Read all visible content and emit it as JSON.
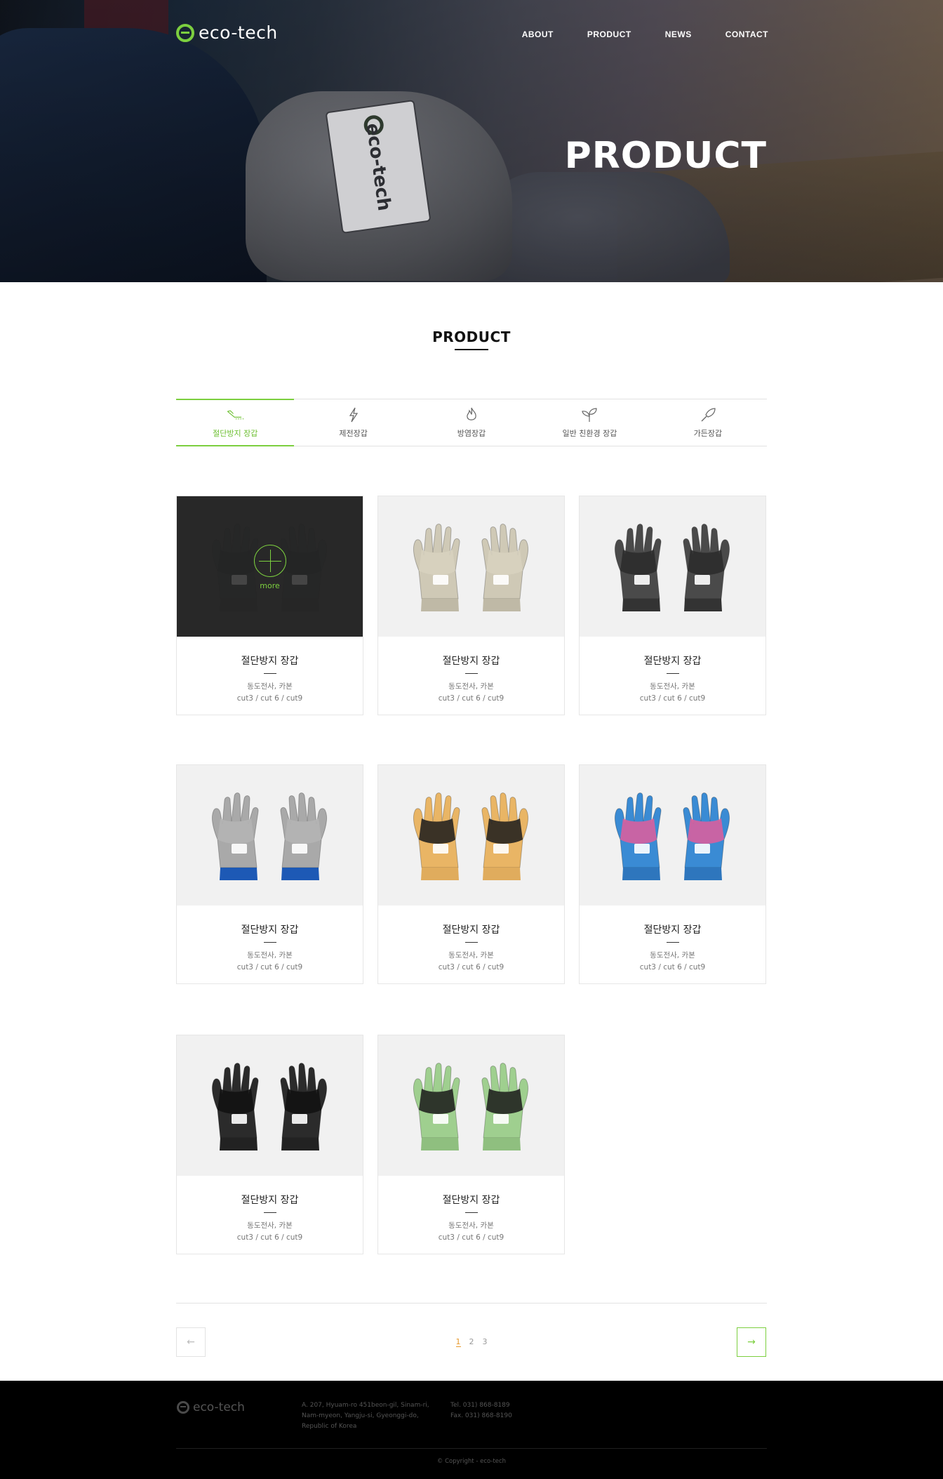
{
  "header": {
    "logo_text": "eco-tech",
    "nav": [
      "ABOUT",
      "PRODUCT",
      "NEWS",
      "CONTACT"
    ],
    "hero_title": "PRODUCT",
    "hero_badge_text": "eco-tech"
  },
  "section": {
    "title": "PRODUCT"
  },
  "tabs": [
    {
      "label": "절단방지 장갑",
      "icon": "cut-blade-icon",
      "active": true
    },
    {
      "label": "제전장갑",
      "icon": "lightning-icon",
      "active": false
    },
    {
      "label": "방염장갑",
      "icon": "flame-icon",
      "active": false
    },
    {
      "label": "일반 친환경 장갑",
      "icon": "sprout-icon",
      "active": false
    },
    {
      "label": "가든장갑",
      "icon": "trowel-icon",
      "active": false
    }
  ],
  "products": [
    {
      "title": "절단방지 장갑",
      "desc1": "동도전사, 카본",
      "desc2": "cut3 / cut 6 / cut9",
      "glove": "#1e2426",
      "cuff": "#1b1e20",
      "palm": "#0f1213"
    },
    {
      "title": "절단방지 장갑",
      "desc1": "동도전사, 카본",
      "desc2": "cut3 / cut 6 / cut9",
      "glove": "#cfc9b6",
      "cuff": "#bfb9a6",
      "palm": "#d8d2bf"
    },
    {
      "title": "절단방지 장갑",
      "desc1": "동도전사, 카본",
      "desc2": "cut3 / cut 6 / cut9",
      "glove": "#4a4a4a",
      "cuff": "#333333",
      "palm": "#2a2a2a"
    },
    {
      "title": "절단방지 장갑",
      "desc1": "동도전사, 카본",
      "desc2": "cut3 / cut 6 / cut9",
      "glove": "#a9a9a9",
      "cuff": "#1d59b5",
      "palm": "#b5b5b5"
    },
    {
      "title": "절단방지 장갑",
      "desc1": "동도전사, 카본",
      "desc2": "cut3 / cut 6 / cut9",
      "glove": "#e9b565",
      "cuff": "#e0ac5d",
      "palm": "#1b1b1b"
    },
    {
      "title": "절단방지 장갑",
      "desc1": "동도전사, 카본",
      "desc2": "cut3 / cut 6 / cut9",
      "glove": "#3a8bd4",
      "cuff": "#2e76bd",
      "palm": "#e25d9b"
    },
    {
      "title": "절단방지 장갑",
      "desc1": "동도전사, 카본",
      "desc2": "cut3 / cut 6 / cut9",
      "glove": "#2b2b2b",
      "cuff": "#222222",
      "palm": "#111111"
    },
    {
      "title": "절단방지 장갑",
      "desc1": "동도전사, 카본",
      "desc2": "cut3 / cut 6 / cut9",
      "glove": "#9fcf8f",
      "cuff": "#8fbf7f",
      "palm": "#1a1a1a"
    }
  ],
  "overlay": {
    "text": "more"
  },
  "pagination": {
    "pages": [
      "1",
      "2",
      "3"
    ],
    "current": "1",
    "prev": "←",
    "next": "→"
  },
  "footer": {
    "logo_text": "eco-tech",
    "address": "A. 207, Hyuam-ro 451beon-gil, Sinam-ri, Nam-myeon, Yangju-si, Gyeonggi-do, Republic of Korea",
    "tel": "Tel.   031) 868-8189",
    "fax": "Fax.  031) 868-8190",
    "copyright": "© Copyright - eco-tech"
  },
  "colors": {
    "accent": "#7ccf3f",
    "page_active": "#e79a2e",
    "footer_bg": "#000000"
  }
}
